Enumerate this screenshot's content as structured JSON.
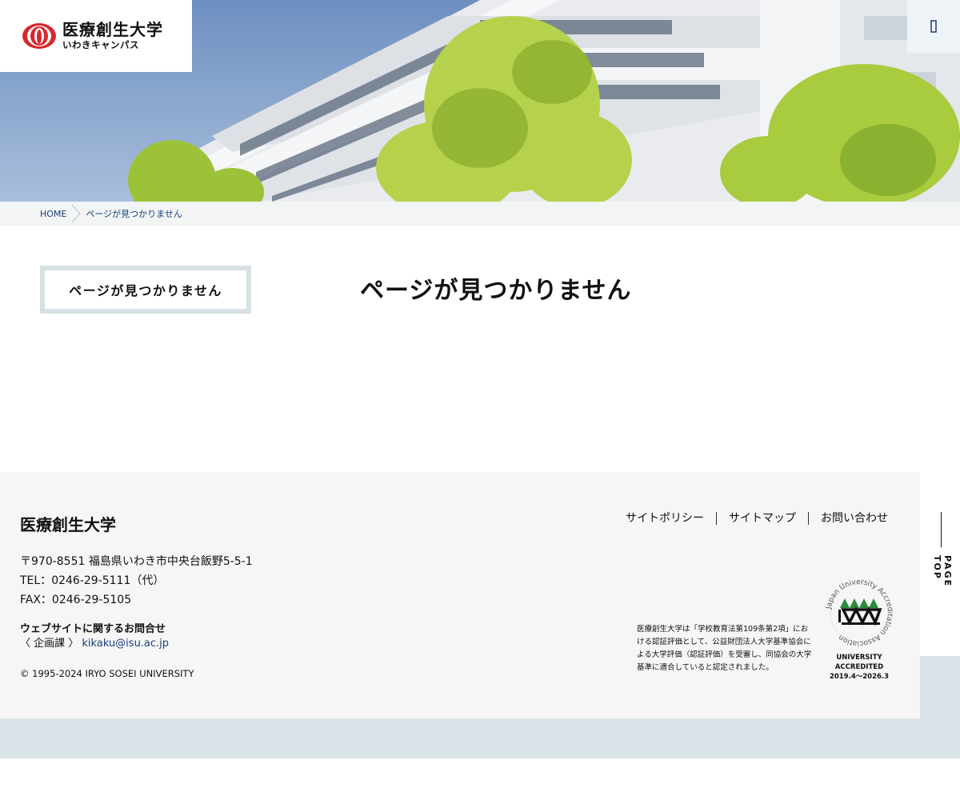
{
  "header": {
    "logo_main": "医療創生大学",
    "logo_sub": "いわきキャンパス",
    "menu_icon": "menu-icon"
  },
  "breadcrumb": {
    "home": "HOME",
    "current": "ページが見つかりません"
  },
  "sidebar": {
    "item": "ページが見つかりません"
  },
  "main": {
    "title": "ページが見つかりません"
  },
  "footer": {
    "name": "医療創生大学",
    "address": "〒970-8551 福島県いわき市中央台飯野5-5-1",
    "tel": "TEL：0246-29-5111（代）",
    "fax": "FAX：0246-29-5105",
    "inquiry_title": "ウェブサイトに関するお問合せ",
    "inquiry_dept": "〈 企画課 〉",
    "inquiry_email": "kikaku@isu.ac.jp",
    "copyright": "© 1995-2024 IRYO SOSEI UNIVERSITY",
    "links": [
      "サイトポリシー",
      "サイトマップ",
      "お問い合わせ"
    ],
    "accreditation": "医療創生大学は「学校教育法第109条第2項」における認証評価として、公益財団法人大学基準協会による大学評価（認証評価）を受審し、同協会の大学基準に適合していると認定されました。",
    "badge_line1": "UNIVERSITY",
    "badge_line2": "ACCREDITED",
    "badge_line3": "2019.4～2026.3",
    "badge_ring": "Japan University Accreditation Association",
    "page_top": "PAGE TOP"
  },
  "colors": {
    "accent": "#1b3f7a",
    "logo_red": "#d7282f",
    "footer_bg": "#f6f6f6",
    "band": "#dae3e8"
  }
}
